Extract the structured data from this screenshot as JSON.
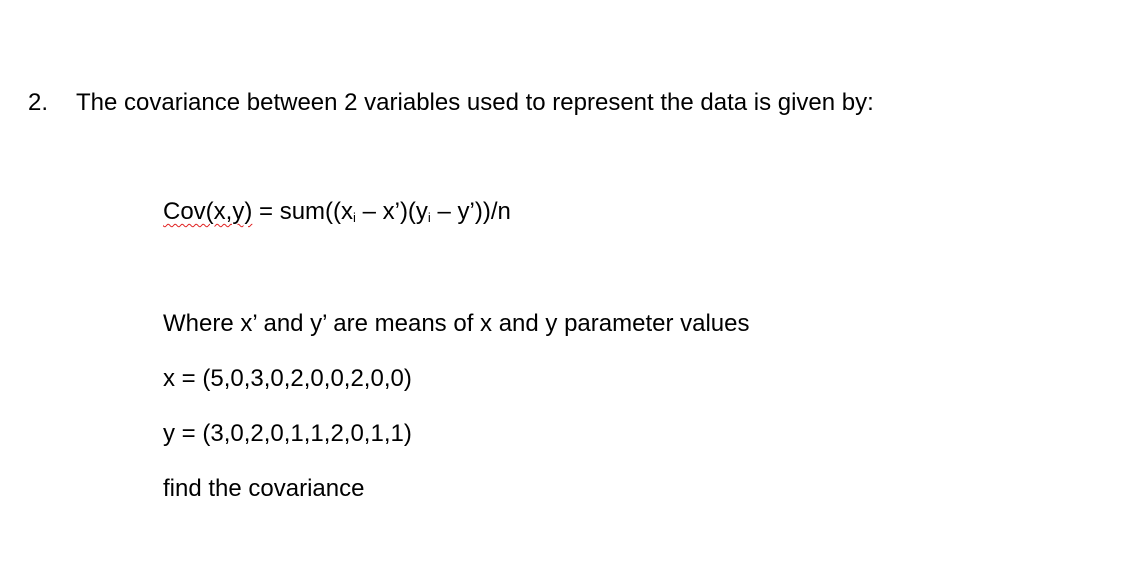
{
  "question": {
    "number": "2.",
    "text": "The covariance between 2 variables used to represent the data is given by:"
  },
  "formula": {
    "lhs": "Cov(x,y)",
    "eq": " = sum((x",
    "sub1": "i",
    "mid": " – x’)(y",
    "sub2": "i",
    "end": " – y’))/n"
  },
  "where_text": "Where x’ and y’ are means of x and y parameter values",
  "x_values": "x = (5,0,3,0,2,0,0,2,0,0)",
  "y_values": "y = (3,0,2,0,1,1,2,0,1,1)",
  "task": "find the covariance"
}
